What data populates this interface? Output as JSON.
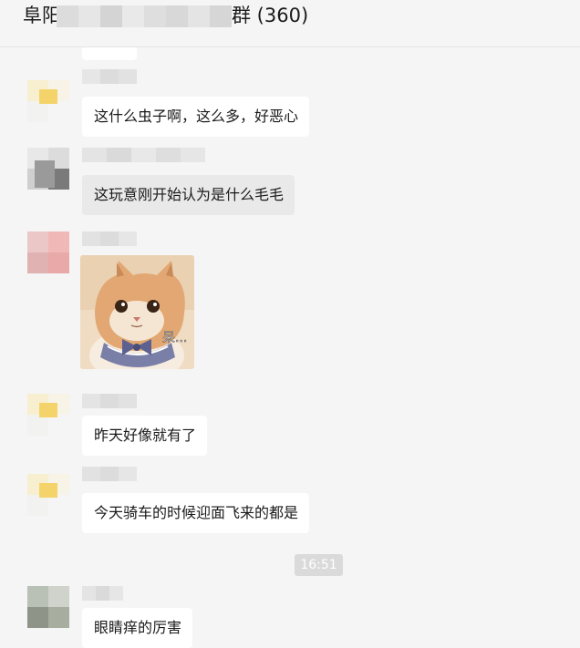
{
  "header": {
    "title_prefix": "阜阳",
    "title_suffix": "群 (360)"
  },
  "messages": [
    {
      "text": "这什么虫子啊，这么多，好恶心"
    },
    {
      "text": "这玩意刚开始认为是什么毛毛"
    },
    {
      "sticker": "cat-with-bow-sticker",
      "sticker_text": "呆..."
    },
    {
      "text": "昨天好像就有了"
    },
    {
      "text": "今天骑车的时候迎面飞来的都是"
    },
    {
      "text": "眼睛痒的厉害"
    }
  ],
  "timestamp": "16:51",
  "colors": {
    "background": "#f5f5f5",
    "bubble": "#ffffff",
    "bubble_selected": "#e9e9e9",
    "time_pill": "#dadada"
  }
}
